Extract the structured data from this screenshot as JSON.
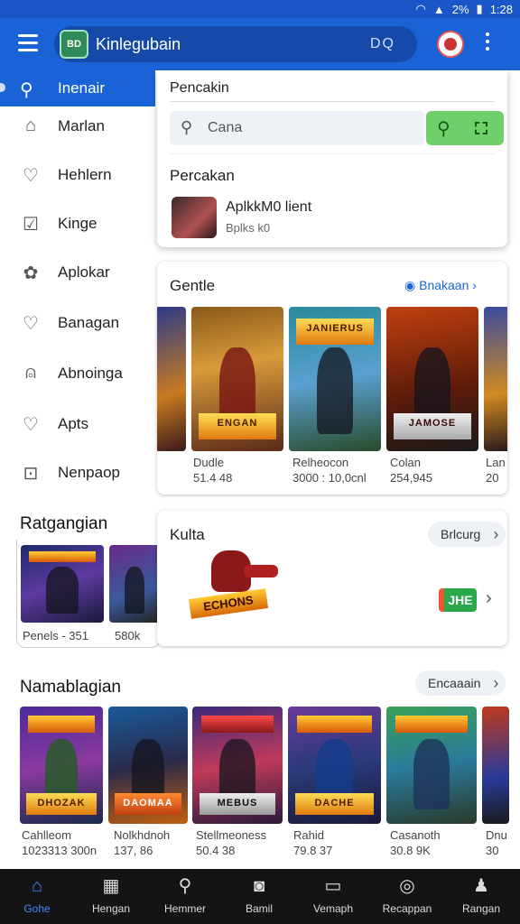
{
  "status_bar": {
    "battery": "2%",
    "time": "1:28"
  },
  "app_bar": {
    "brand": "Kinlegubain",
    "search_hint": "DQ",
    "logo_text": "BD"
  },
  "drawer": {
    "active_item": "Inenair",
    "items": [
      {
        "label": "Marlan",
        "icon": "home-icon"
      },
      {
        "label": "Hehlern",
        "icon": "heart-icon"
      },
      {
        "label": "Kinge",
        "icon": "checkbox-icon"
      },
      {
        "label": "Aplokar",
        "icon": "flower-icon"
      },
      {
        "label": "Banagan",
        "icon": "heart-outline-icon"
      },
      {
        "label": "Abnoinga",
        "icon": "person-icon"
      },
      {
        "label": "Apts",
        "icon": "heart-icon"
      },
      {
        "label": "Nenpaop",
        "icon": "inbox-icon"
      }
    ],
    "section_title": "Ratgangian",
    "section_items": [
      {
        "meta": "Penels - 351"
      },
      {
        "meta": "580k"
      }
    ]
  },
  "search_panel": {
    "title": "Pencakin",
    "placeholder": "Cana",
    "results_title": "Percakan",
    "result": {
      "name": "AplkkM0 lient",
      "sub": "Bplks k0"
    }
  },
  "card_genre": {
    "title": "Gentle",
    "link": "Bnakaan",
    "items": [
      {
        "title": "Dudle",
        "sub": "51.4 48"
      },
      {
        "title": "Relheocon",
        "sub": "3000 : 10,0cnl",
        "banner": "JANIERUS",
        "banner2": ""
      },
      {
        "title": "Colan",
        "sub": "254,945",
        "banner": "JAMOSE"
      },
      {
        "title": "Lan",
        "sub": "20"
      }
    ],
    "banner_main": "ENGAN"
  },
  "card_kulta": {
    "title": "Kulta",
    "pill": "Brlcurg",
    "badge": "JHE",
    "logo_text": "ECHONS"
  },
  "section_namab": {
    "title": "Namablagian",
    "pill": "Encaaain",
    "items": [
      {
        "title": "Cahlleom",
        "sub": "1023313 300n",
        "banner": "DHOZAK"
      },
      {
        "title": "Nolkhdnoh",
        "sub": "137, 86",
        "banner": "DAOMAA"
      },
      {
        "title": "Stellmeoness",
        "sub": "50.4 38",
        "banner": "MEBUS"
      },
      {
        "title": "Rahid",
        "sub": "79.8 37",
        "banner": "DACHE"
      },
      {
        "title": "Casanoth",
        "sub": "30.8 9K",
        "banner": ""
      },
      {
        "title": "Dnu",
        "sub": "30"
      }
    ]
  },
  "bottom_nav": [
    {
      "label": "Gohe",
      "icon": "home-icon"
    },
    {
      "label": "Hengan",
      "icon": "grid-icon"
    },
    {
      "label": "Hemmer",
      "icon": "search-icon"
    },
    {
      "label": "Bamil",
      "icon": "gamepad-icon"
    },
    {
      "label": "Vemaph",
      "icon": "chat-icon"
    },
    {
      "label": "Recappan",
      "icon": "compass-icon"
    },
    {
      "label": "Rangan",
      "icon": "user-icon"
    }
  ]
}
